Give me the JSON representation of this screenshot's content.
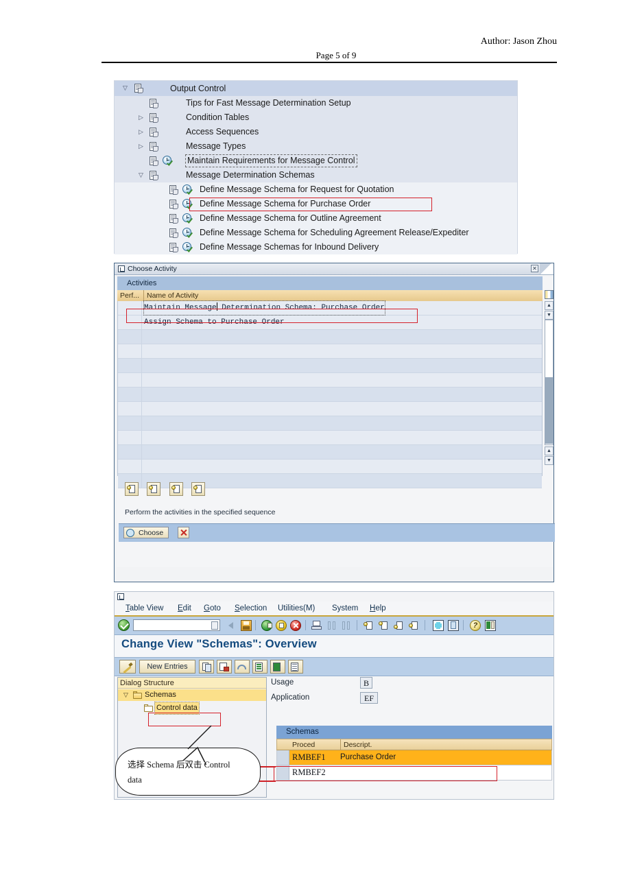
{
  "document": {
    "author": "Author: Jason Zhou",
    "page_label": "Page 5 of 9"
  },
  "img_tree": {
    "rows": [
      {
        "label": "Output Control",
        "level": 0,
        "twist": "expanded",
        "icon": "document-icon",
        "clock": false,
        "dotted": false
      },
      {
        "label": "Tips for Fast Message Determination Setup",
        "level": 1,
        "twist": "none",
        "icon": "document-icon",
        "clock": false,
        "dotted": false
      },
      {
        "label": "Condition Tables",
        "level": 1,
        "twist": "collapsed",
        "icon": "document-icon",
        "clock": false,
        "dotted": false
      },
      {
        "label": "Access Sequences",
        "level": 1,
        "twist": "collapsed",
        "icon": "document-icon",
        "clock": false,
        "dotted": false
      },
      {
        "label": "Message Types",
        "level": 1,
        "twist": "collapsed",
        "icon": "document-icon",
        "clock": false,
        "dotted": false
      },
      {
        "label": "Maintain Requirements for Message Control",
        "level": 1,
        "twist": "none",
        "icon": "document-icon",
        "clock": true,
        "dotted": true
      },
      {
        "label": "Message Determination Schemas",
        "level": 1,
        "twist": "expanded",
        "icon": "document-icon",
        "clock": false,
        "dotted": false
      },
      {
        "label": "Define Message Schema for Request for Quotation",
        "level": 2,
        "twist": "none",
        "icon": "document-icon",
        "clock": true,
        "dotted": false
      },
      {
        "label": "Define Message Schema for Purchase Order",
        "level": 2,
        "twist": "none",
        "icon": "document-icon",
        "clock": true,
        "dotted": false
      },
      {
        "label": "Define Message Schema for Outline Agreement",
        "level": 2,
        "twist": "none",
        "icon": "document-icon",
        "clock": true,
        "dotted": false
      },
      {
        "label": "Define Message Schema for Scheduling Agreement Release/Expediter",
        "level": 2,
        "twist": "none",
        "icon": "document-icon",
        "clock": true,
        "dotted": false
      },
      {
        "label": "Define Message Schemas for Inbound Delivery",
        "level": 2,
        "twist": "none",
        "icon": "document-icon",
        "clock": true,
        "dotted": false
      }
    ],
    "highlight_row_index": 8
  },
  "choose_activity": {
    "title": "Choose Activity",
    "close_label": "✕",
    "group_header": "Activities",
    "columns": [
      "Perf...",
      "Name of Activity"
    ],
    "rows": [
      "Maintain Message Determination Schema: Purchase Order",
      "Assign Schema to Purchase Order"
    ],
    "highlight_row_index": 0,
    "hint": "Perform the activities in the specified sequence",
    "choose_button": "Choose",
    "toolbar_icons": [
      "doc-copy-icon",
      "doc-new-icon",
      "doc-detail-icon",
      "doc-variant-icon"
    ]
  },
  "sap_window": {
    "menu": [
      "Table View",
      "Edit",
      "Goto",
      "Selection",
      "Utilities(M)",
      "System",
      "Help"
    ],
    "menu_mnemonic_index": [
      1,
      1,
      1,
      1,
      0,
      0,
      1
    ],
    "command_field_value": "",
    "title": "Change View \"Schemas\": Overview",
    "app_toolbar": {
      "new_entries_label": "New Entries",
      "icons": [
        "pencil-icon",
        "copy-icon",
        "delete-icon",
        "undo-icon",
        "select-all-icon",
        "deselect-all-icon",
        "details-icon"
      ]
    },
    "dialog_structure": {
      "header": "Dialog Structure",
      "items": [
        {
          "label": "Schemas",
          "level": 0,
          "twist": "expanded",
          "selected": true
        },
        {
          "label": "Control data",
          "level": 1,
          "twist": "none",
          "selected": false
        }
      ]
    },
    "fields": [
      {
        "label": "Usage",
        "value": "B"
      },
      {
        "label": "Application",
        "value": "EF"
      }
    ],
    "table": {
      "section_header": "Schemas",
      "columns": [
        "Proced",
        "Descript."
      ],
      "rows": [
        {
          "proced": "RMBEF1",
          "descript": "Purchase Order",
          "highlight": true
        },
        {
          "proced": "RMBEF2",
          "descript": "",
          "highlight": false
        }
      ]
    },
    "callout": {
      "line1": "选择 Schema 后双击 Control",
      "line2": "data"
    }
  },
  "colors": {
    "highlight_red": "#cf2026",
    "sap_title_blue": "#134a7e",
    "toolbar_blue": "#b9cfe8",
    "row_orange": "#ffb21a",
    "tree_selected": "#fbe08a"
  }
}
